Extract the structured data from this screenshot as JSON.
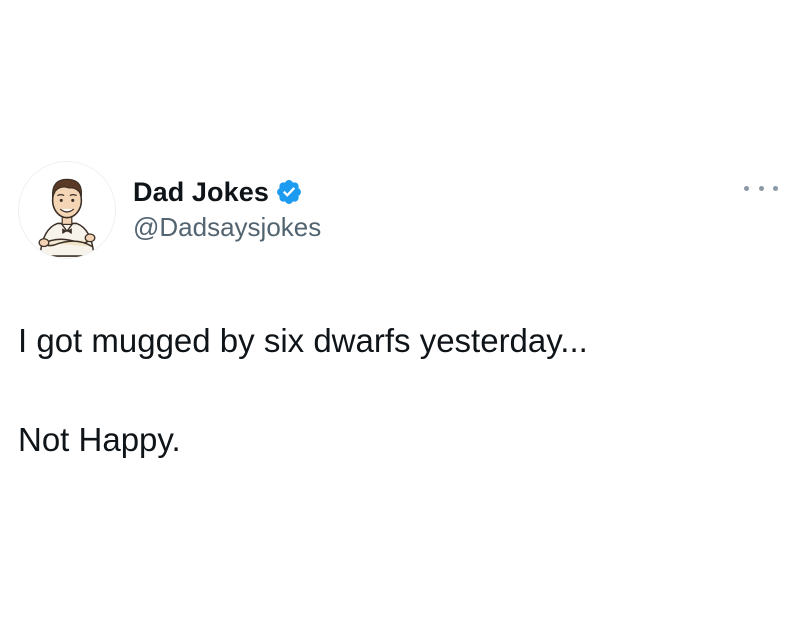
{
  "author": {
    "display_name": "Dad Jokes",
    "handle": "@Dadsaysjokes",
    "verified": true,
    "verified_color": "#1d9bf0",
    "avatar_icon": "cartoon-man-arms-crossed"
  },
  "tweet": {
    "lines": [
      "I got mugged by six dwarfs yesterday...",
      "Not Happy."
    ]
  },
  "actions": {
    "more_icon": "more-horizontal-icon"
  },
  "colors": {
    "text_primary": "#0f1419",
    "text_secondary": "#536471",
    "background": "#ffffff"
  }
}
